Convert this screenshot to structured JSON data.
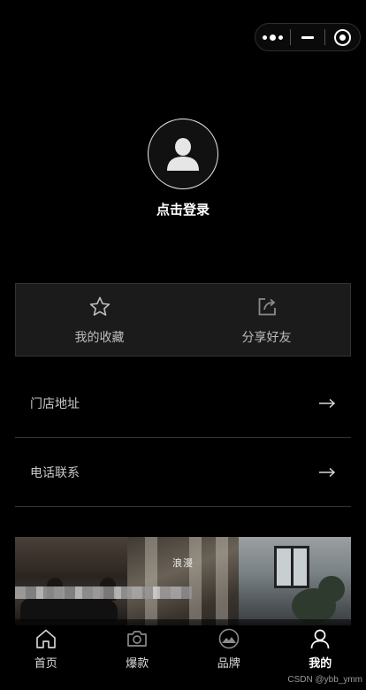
{
  "profile": {
    "login_label": "点击登录"
  },
  "actions": [
    {
      "label": "我的收藏",
      "icon": "star-icon"
    },
    {
      "label": "分享好友",
      "icon": "share-icon"
    }
  ],
  "menu": [
    {
      "label": "门店地址",
      "icon": "arrow-right-icon"
    },
    {
      "label": "电话联系",
      "icon": "arrow-right-icon"
    }
  ],
  "banner": {
    "caption": "浪漫"
  },
  "tabbar": [
    {
      "label": "首页",
      "icon": "home-icon",
      "active": false
    },
    {
      "label": "爆款",
      "icon": "camera-icon",
      "active": false
    },
    {
      "label": "品牌",
      "icon": "image-icon",
      "active": false
    },
    {
      "label": "我的",
      "icon": "user-icon",
      "active": true
    }
  ],
  "watermark": "CSDN @ybb_ymm",
  "colors": {
    "background": "#000000",
    "card": "#1b1b1b",
    "divider": "#333333",
    "text_muted": "#bdbdbd"
  }
}
